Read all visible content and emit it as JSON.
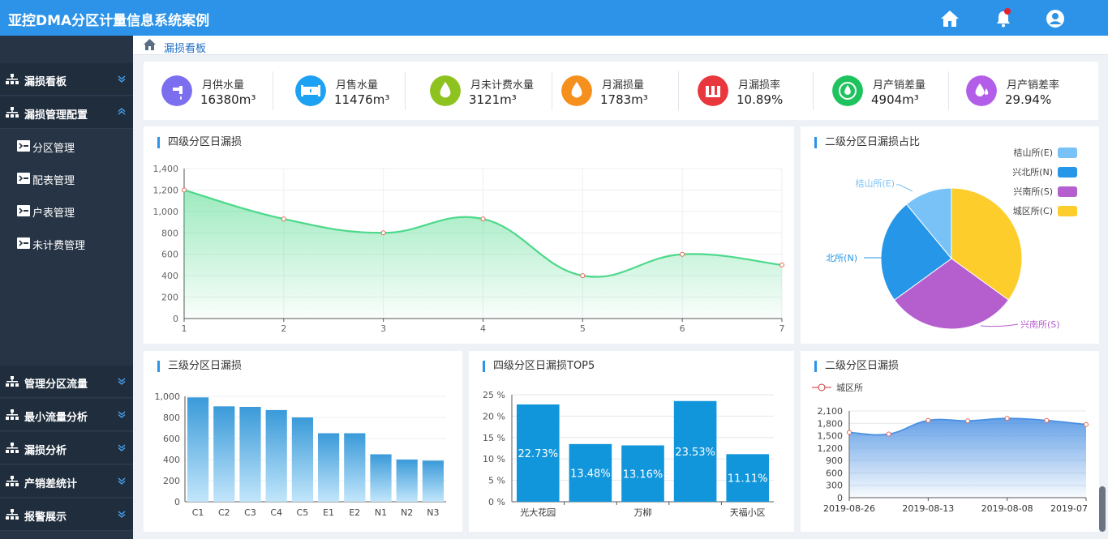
{
  "header": {
    "title": "亚控DMA分区计量信息系统案例"
  },
  "sidebar": {
    "items": [
      {
        "label": "漏损看板"
      },
      {
        "label": "漏损管理配置"
      }
    ],
    "sub_items": [
      {
        "label": "分区管理"
      },
      {
        "label": "配表管理"
      },
      {
        "label": "户表管理"
      },
      {
        "label": "未计费管理"
      }
    ],
    "bottom_items": [
      {
        "label": "管理分区流量"
      },
      {
        "label": "最小流量分析"
      },
      {
        "label": "漏损分析"
      },
      {
        "label": "产销差统计"
      },
      {
        "label": "报警展示"
      }
    ]
  },
  "breadcrumb": {
    "label": "漏损看板"
  },
  "kpis": [
    {
      "label": "月供水量",
      "value": "16380m³",
      "color": "#7b6ff0",
      "icon": "faucet-icon"
    },
    {
      "label": "月售水量",
      "value": "11476m³",
      "color": "#1da1f2",
      "icon": "pipe-icon"
    },
    {
      "label": "月未计费水量",
      "value": "3121m³",
      "color": "#8dc21f",
      "icon": "water-drop-icon"
    },
    {
      "label": "月漏损量",
      "value": "1783m³",
      "color": "#f5901e",
      "icon": "leak-drop-icon"
    },
    {
      "label": "月漏损率",
      "value": "10.89%",
      "color": "#e8383d",
      "icon": "leak-rate-icon"
    },
    {
      "label": "月产销差量",
      "value": "4904m³",
      "color": "#1ec35e",
      "icon": "drop-circle-icon"
    },
    {
      "label": "月产销差率",
      "value": "29.94%",
      "color": "#b35ee8",
      "icon": "drops-icon"
    }
  ],
  "panels": {
    "level4_daily": "四级分区日漏损",
    "level2_share": "二级分区日漏损占比",
    "level3_daily": "三级分区日漏损",
    "level4_top5": "四级分区日漏损TOP5",
    "level2_daily": "二级分区日漏损"
  },
  "chart_data": [
    {
      "type": "area",
      "title": "四级分区日漏损",
      "x": [
        1,
        2,
        3,
        4,
        5,
        6,
        7
      ],
      "values": [
        1200,
        930,
        800,
        930,
        400,
        600,
        500
      ],
      "ylim": [
        0,
        1400
      ],
      "yticks": [
        "0",
        "200",
        "400",
        "600",
        "800",
        "1,000",
        "1,200",
        "1,400"
      ],
      "color": "#4cd98a",
      "grid": true
    },
    {
      "type": "pie",
      "title": "二级分区日漏损占比",
      "legend_position": "top-right",
      "slices": [
        {
          "name": "桔山所(E)",
          "value": 11,
          "color": "#79c2f7"
        },
        {
          "name": "兴北所(N)",
          "value": 24,
          "color": "#2596e8"
        },
        {
          "name": "兴南所(S)",
          "value": 30,
          "color": "#b55fcf"
        },
        {
          "name": "城区所(C)",
          "value": 35,
          "color": "#fdcd2b"
        }
      ],
      "slice_labels": [
        "桔山所(E)",
        "北所(N)",
        "兴南所(S)"
      ]
    },
    {
      "type": "bar",
      "title": "三级分区日漏损",
      "categories": [
        "C1",
        "C2",
        "C3",
        "C4",
        "C5",
        "E1",
        "E2",
        "N1",
        "N2",
        "N3"
      ],
      "values": [
        990,
        905,
        900,
        870,
        800,
        650,
        650,
        450,
        400,
        390
      ],
      "ylim": [
        0,
        1000
      ],
      "yticks": [
        "0",
        "200",
        "400",
        "600",
        "800",
        "1,000"
      ]
    },
    {
      "type": "bar",
      "title": "四级分区日漏损TOP5",
      "categories": [
        "光大花园",
        "",
        "万柳",
        "",
        "天福小区"
      ],
      "values": [
        22.73,
        13.48,
        13.16,
        23.53,
        11.11
      ],
      "value_labels": [
        "22.73%",
        "13.48%",
        "13.16%",
        "23.53%",
        "11.11%"
      ],
      "ylim": [
        0,
        25
      ],
      "yticks": [
        "0 %",
        "5 %",
        "10 %",
        "15 %",
        "20 %",
        "25 %"
      ],
      "color": "#1296db"
    },
    {
      "type": "area",
      "title": "二级分区日漏损",
      "legend_position": "top-left",
      "series": [
        {
          "name": "城区所",
          "values": [
            1580,
            1540,
            1870,
            1860,
            1920,
            1870,
            1770
          ]
        }
      ],
      "points": 7,
      "x_tick_labels": [
        "2019-08-26",
        "2019-08-13",
        "2019-08-08",
        "2019-07"
      ],
      "ylim": [
        0,
        2100
      ],
      "yticks": [
        "0",
        "300",
        "600",
        "900",
        "1,200",
        "1,500",
        "1,800",
        "2,100"
      ],
      "color": "#4a90e2"
    }
  ]
}
